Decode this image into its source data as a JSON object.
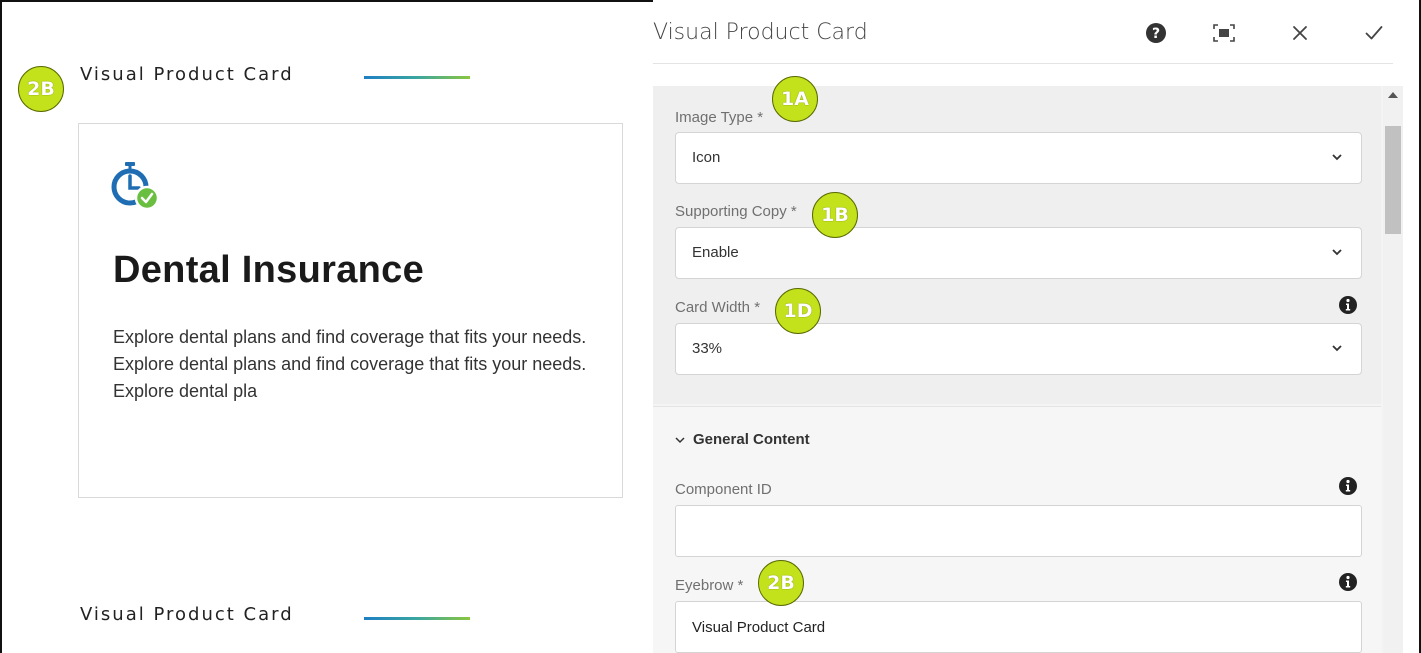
{
  "preview": {
    "eyebrow_top": "Visual Product Card",
    "eyebrow_bottom": "Visual Product Card",
    "card": {
      "icon": "stopwatch-check-icon",
      "title": "Dental Insurance",
      "body": "Explore dental plans and find coverage that fits your needs. Explore dental plans and find coverage that fits your needs. Explore dental pla"
    }
  },
  "dialog": {
    "title": "Visual Product Card",
    "header_icons": [
      "help-icon",
      "fullscreen-icon",
      "close-icon",
      "done-check-icon"
    ],
    "fields": {
      "image_type": {
        "label": "Image Type *",
        "value": "Icon"
      },
      "supporting_copy": {
        "label": "Supporting Copy *",
        "value": "Enable"
      },
      "card_width": {
        "label": "Card Width *",
        "value": "33%"
      },
      "general_content": {
        "label": "General Content"
      },
      "component_id": {
        "label": "Component ID",
        "value": ""
      },
      "eyebrow": {
        "label": "Eyebrow *",
        "value": "Visual Product Card"
      }
    }
  },
  "annotations": {
    "b2b_left": "2B",
    "b1a": "1A",
    "b1b": "1B",
    "b1d": "1D",
    "b2b_right": "2B"
  },
  "colors": {
    "badge": "#c4e21c",
    "accent_line_start": "#1f7fc4",
    "accent_line_end": "#8cc63f",
    "icon_blue": "#1f6db3",
    "icon_green": "#6abf40"
  }
}
